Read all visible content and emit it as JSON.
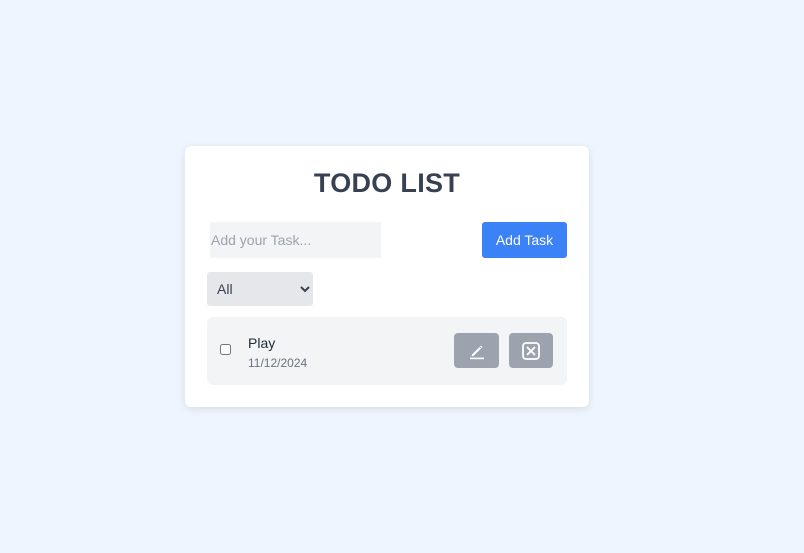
{
  "app": {
    "title": "TODO LIST"
  },
  "new_task": {
    "placeholder": "Add your Task...",
    "value": ""
  },
  "add_button": {
    "label": "Add Task"
  },
  "filter": {
    "selected": "All"
  },
  "todos": [
    {
      "name": "Play",
      "date": "11/12/2024",
      "completed": false
    }
  ],
  "icons": {
    "edit": "pencil-icon",
    "delete": "close-box-icon"
  },
  "colors": {
    "background": "#eef5ff",
    "primary": "#3b82f6",
    "icon_button": "#9ca3af"
  }
}
